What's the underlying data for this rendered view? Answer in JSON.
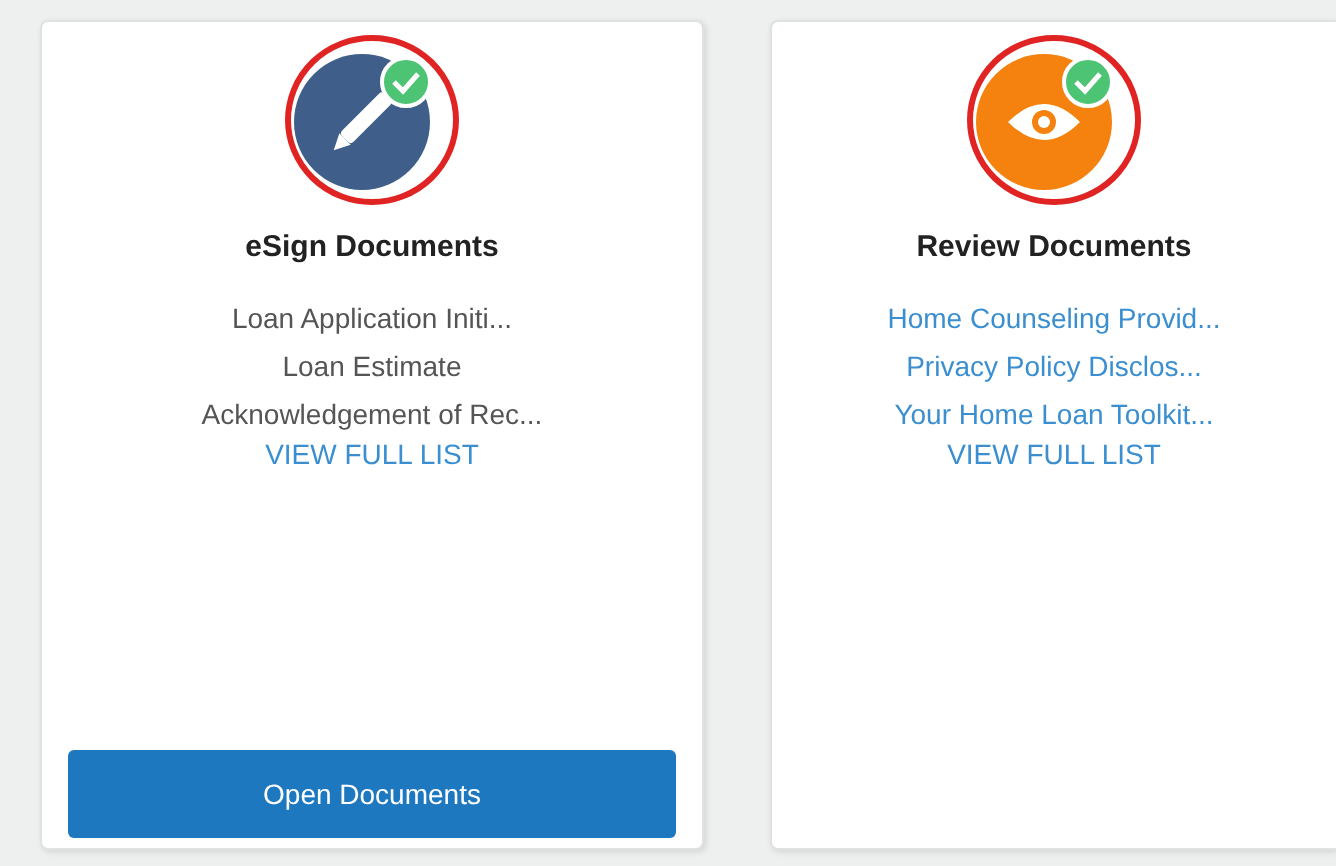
{
  "cards": [
    {
      "title": "eSign Documents",
      "kind": "esign",
      "color": "#3f5f8a",
      "completed": true,
      "highlighted": true,
      "documents": [
        {
          "name": "Loan Application Initi...",
          "kind": "text"
        },
        {
          "name": "Loan Estimate",
          "kind": "text"
        },
        {
          "name": "Acknowledgement of Rec...",
          "kind": "text"
        }
      ],
      "view_all": "VIEW FULL LIST",
      "button": "Open Documents"
    },
    {
      "title": "Review Documents",
      "kind": "review",
      "color": "#f5820f",
      "completed": true,
      "highlighted": true,
      "documents": [
        {
          "name": "Home Counseling Provid...",
          "kind": "link"
        },
        {
          "name": "Privacy Policy Disclos...",
          "kind": "link"
        },
        {
          "name": "Your Home Loan Toolkit...",
          "kind": "link"
        }
      ],
      "view_all": "VIEW FULL LIST"
    }
  ]
}
